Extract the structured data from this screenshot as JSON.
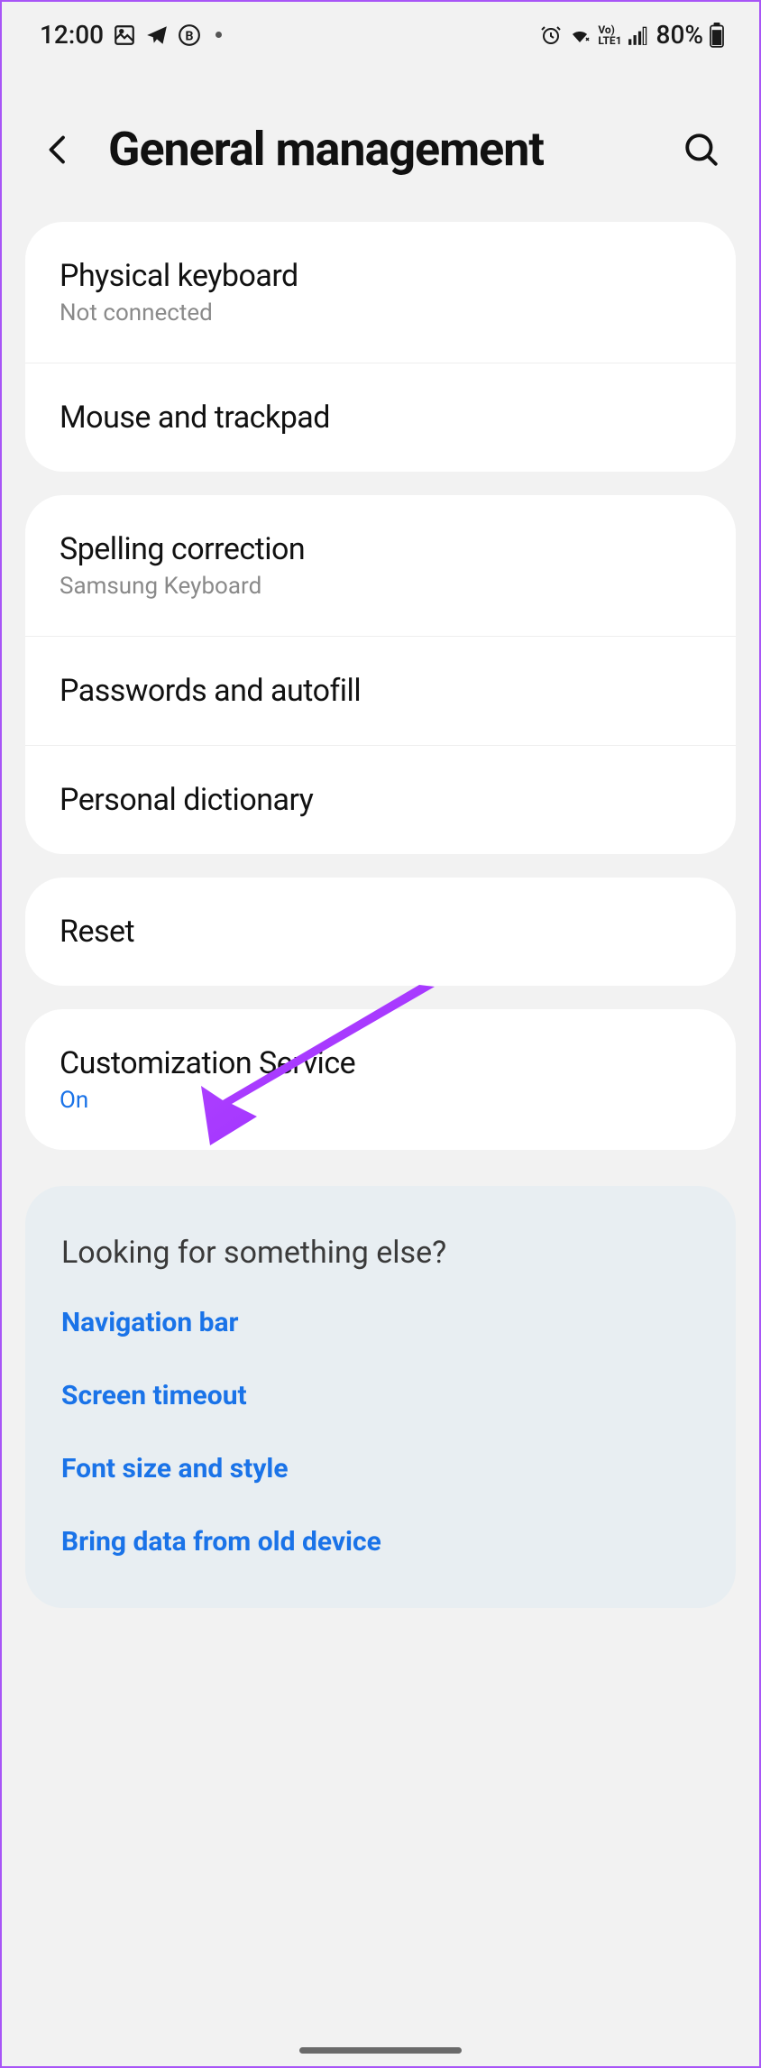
{
  "status": {
    "time": "12:00",
    "battery": "80%"
  },
  "header": {
    "title": "General management"
  },
  "groups": [
    {
      "items": [
        {
          "title": "Physical keyboard",
          "sub": "Not connected"
        },
        {
          "title": "Mouse and trackpad"
        }
      ]
    },
    {
      "items": [
        {
          "title": "Spelling correction",
          "sub": "Samsung Keyboard"
        },
        {
          "title": "Passwords and autofill"
        },
        {
          "title": "Personal dictionary"
        }
      ]
    },
    {
      "items": [
        {
          "title": "Reset"
        }
      ]
    },
    {
      "items": [
        {
          "title": "Customization Service",
          "sub": "On",
          "subBlue": true
        }
      ]
    }
  ],
  "suggest": {
    "title": "Looking for something else?",
    "links": [
      "Navigation bar",
      "Screen timeout",
      "Font size and style",
      "Bring data from old device"
    ]
  }
}
